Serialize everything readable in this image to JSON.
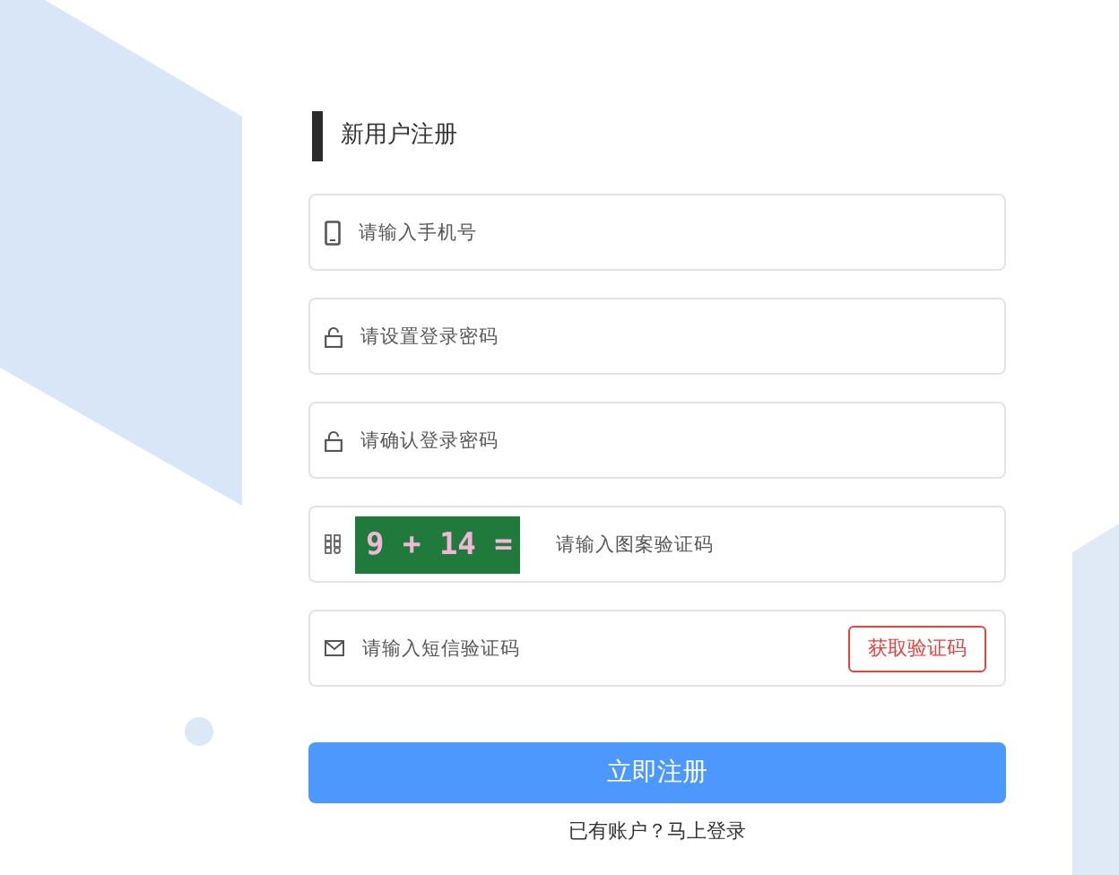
{
  "title": "新用户注册",
  "fields": [
    {
      "kind": "phone",
      "placeholder": "请输入手机号"
    },
    {
      "kind": "password",
      "placeholder": "请设置登录密码"
    },
    {
      "kind": "password",
      "placeholder": "请确认登录密码"
    },
    {
      "kind": "captcha",
      "placeholder": "请输入图案验证码",
      "captcha_text": "9 + 14 ="
    },
    {
      "kind": "sms",
      "placeholder": "请输入短信验证码",
      "button": "获取验证码"
    }
  ],
  "submit": "立即注册",
  "login_link": "已有账户？马上登录"
}
